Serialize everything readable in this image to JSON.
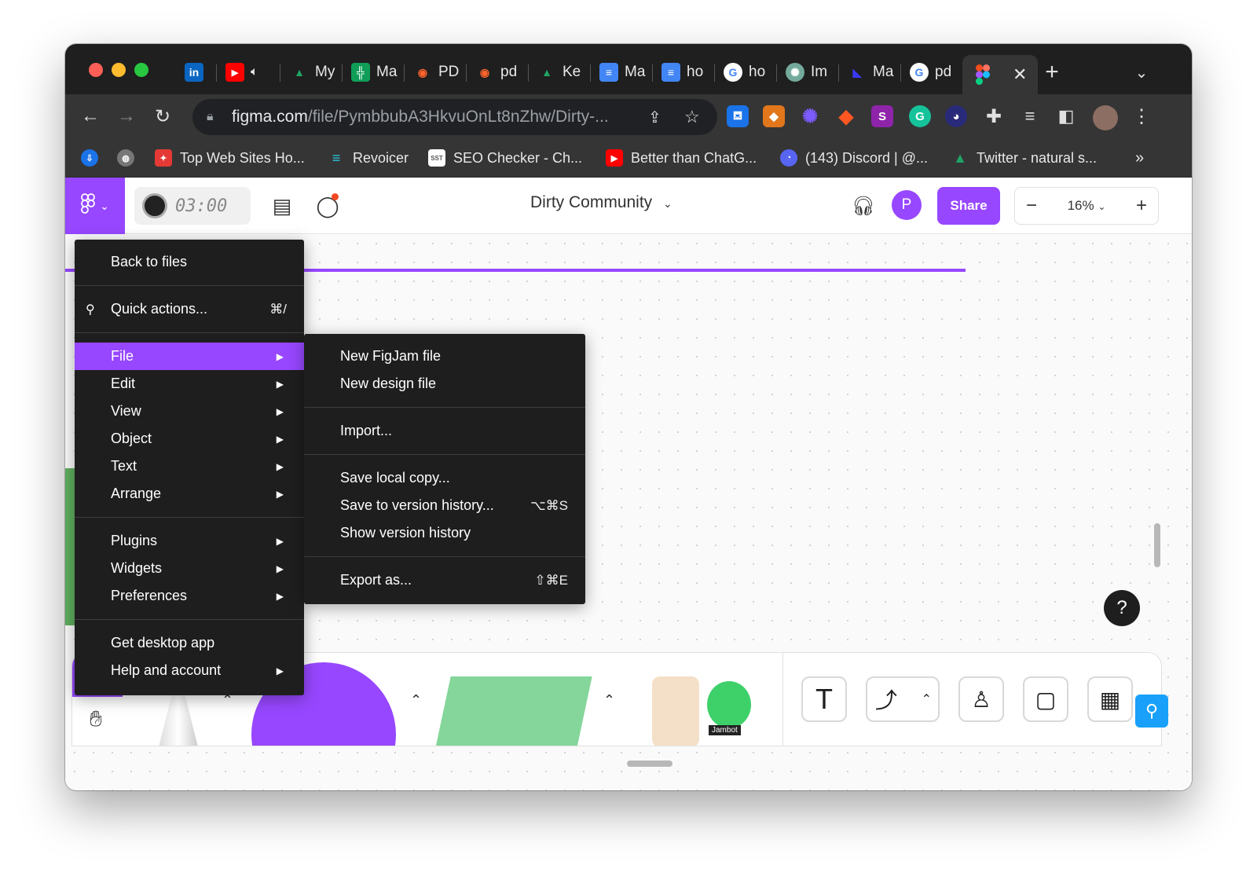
{
  "browser": {
    "tabs": [
      {
        "icon": "linkedin-icon",
        "label": "",
        "color": "#0a66c2",
        "glyph": "in"
      },
      {
        "icon": "youtube-icon",
        "label": "",
        "color": "#ff0000",
        "glyph": "▶"
      },
      {
        "icon": "drive-icon",
        "label": "My",
        "color": "#1fa463",
        "glyph": "▲"
      },
      {
        "icon": "sheets-icon",
        "label": "Ma",
        "color": "#0f9d58",
        "glyph": "╬"
      },
      {
        "icon": "semrush-icon",
        "label": "PD",
        "color": "#ff642d",
        "glyph": "◉"
      },
      {
        "icon": "semrush-icon",
        "label": "pd",
        "color": "#ff642d",
        "glyph": "◉"
      },
      {
        "icon": "drive-icon",
        "label": "Ke",
        "color": "#1fa463",
        "glyph": "▲"
      },
      {
        "icon": "docs-icon",
        "label": "Ma",
        "color": "#4285f4",
        "glyph": "≡"
      },
      {
        "icon": "docs-icon",
        "label": "ho",
        "color": "#4285f4",
        "glyph": "≡"
      },
      {
        "icon": "google-icon",
        "label": "ho",
        "color": "#ffffff",
        "glyph": "G"
      },
      {
        "icon": "chatgpt-icon",
        "label": "Im",
        "color": "#74aa9c",
        "glyph": "✺"
      },
      {
        "icon": "app-icon",
        "label": "Ma",
        "color": "#3a3aff",
        "glyph": "◣"
      },
      {
        "icon": "google-icon",
        "label": "pd",
        "color": "#ffffff",
        "glyph": "G"
      }
    ],
    "active_tab_icon": "figma-icon",
    "url_host": "figma.com",
    "url_path": "/file/PymbbubA3HkvuOnLt8nZhw/Dirty-...",
    "bookmarks": [
      {
        "icon": "bookmark-icon",
        "label": "",
        "color": "#1a73e8",
        "glyph": "⇩"
      },
      {
        "icon": "globe-icon",
        "label": "",
        "color": "#777777",
        "glyph": "◍"
      },
      {
        "icon": "webstats-icon",
        "label": "Top Web Sites Ho...",
        "color": "#e53935",
        "glyph": "✦"
      },
      {
        "icon": "revoicer-icon",
        "label": "Revoicer",
        "color": "#26c6da",
        "glyph": "≡"
      },
      {
        "icon": "sst-icon",
        "label": "SEO Checker - Ch...",
        "color": "#ffffff",
        "glyph": "SST"
      },
      {
        "icon": "youtube-icon",
        "label": "Better than ChatG...",
        "color": "#ff0000",
        "glyph": "▶"
      },
      {
        "icon": "discord-icon",
        "label": "(143) Discord | @...",
        "color": "#5865f2",
        "glyph": "◔"
      },
      {
        "icon": "drive-icon",
        "label": "Twitter - natural s...",
        "color": "#1fa463",
        "glyph": "▲"
      }
    ],
    "more_bookmarks": "»"
  },
  "figma": {
    "timer": "03:00",
    "doc_title": "Dirty Community",
    "avatar_initial": "P",
    "share_label": "Share",
    "zoom_level": "16%",
    "help_label": "?"
  },
  "main_menu": {
    "items": [
      {
        "label": "Back to files"
      },
      {
        "label": "Quick actions...",
        "shortcut": "⌘/"
      },
      {
        "label": "File"
      },
      {
        "label": "Edit"
      },
      {
        "label": "View"
      },
      {
        "label": "Object"
      },
      {
        "label": "Text"
      },
      {
        "label": "Arrange"
      },
      {
        "label": "Plugins"
      },
      {
        "label": "Widgets"
      },
      {
        "label": "Preferences"
      },
      {
        "label": "Get desktop app"
      },
      {
        "label": "Help and account"
      }
    ]
  },
  "file_submenu": {
    "items": [
      {
        "label": "New FigJam file"
      },
      {
        "label": "New design file"
      },
      {
        "label": "Import..."
      },
      {
        "label": "Save local copy..."
      },
      {
        "label": "Save to version history...",
        "shortcut": "⌥⌘S"
      },
      {
        "label": "Show version history"
      },
      {
        "label": "Export as...",
        "shortcut": "⇧⌘E"
      }
    ]
  },
  "stickers": {
    "jambot_label": "Jambot"
  },
  "colors": {
    "accent": "#9747ff",
    "menu_bg": "#1e1e1e",
    "chrome_bg": "#353535"
  }
}
